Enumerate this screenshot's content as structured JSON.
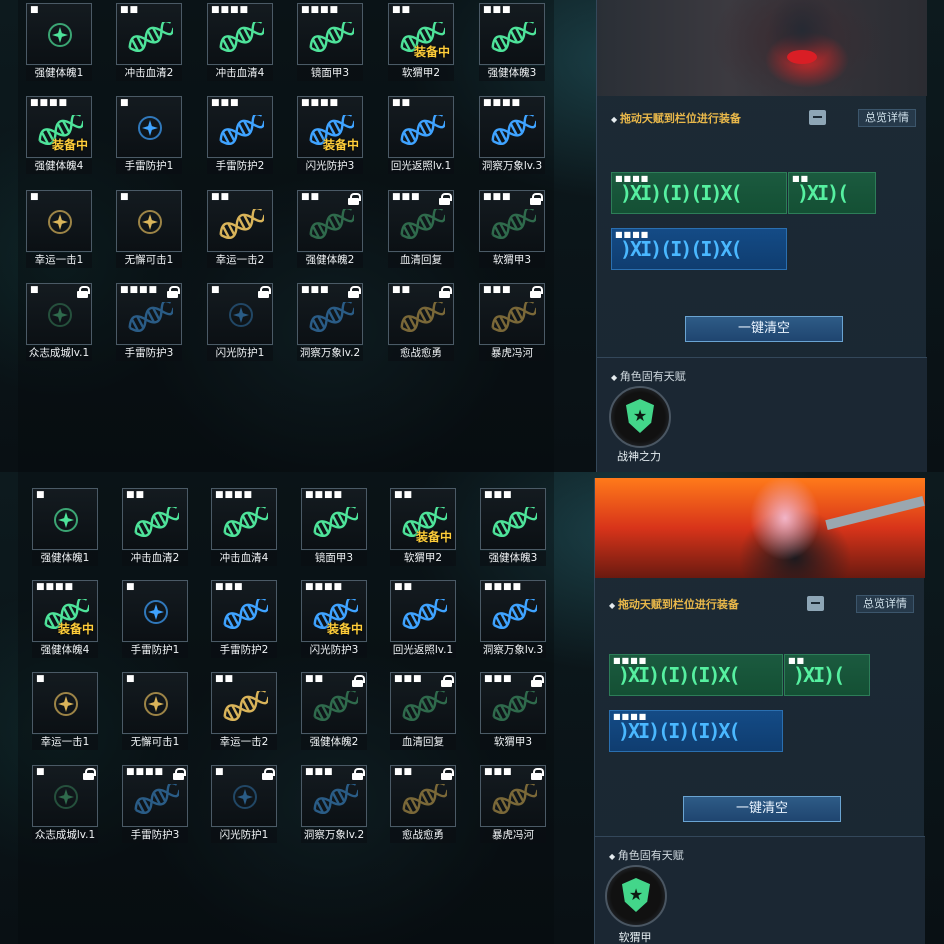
{
  "colors": {
    "green": "#4ee39a",
    "blue": "#3fa3ff",
    "gold": "#d9b45a",
    "dim_green": "#2f6a4c",
    "dim_blue": "#2a5c86",
    "dim_gold": "#7a6838"
  },
  "screens": [
    {
      "cells": [
        {
          "label": "强健体魄1",
          "dots": "■",
          "icon": "gem",
          "color": "green",
          "equipped": "",
          "locked": false
        },
        {
          "label": "冲击血清2",
          "dots": "■■",
          "icon": "dna",
          "color": "green",
          "equipped": "",
          "locked": false
        },
        {
          "label": "冲击血清4",
          "dots": "■■■■",
          "icon": "dna",
          "color": "green",
          "equipped": "",
          "locked": false
        },
        {
          "label": "镜面甲3",
          "dots": "■■■■",
          "icon": "dna",
          "color": "green",
          "equipped": "",
          "locked": false
        },
        {
          "label": "软猬甲2",
          "dots": "■■",
          "icon": "dna",
          "color": "green",
          "equipped": "装备中",
          "locked": false
        },
        {
          "label": "强健体魄3",
          "dots": "■■■",
          "icon": "dna",
          "color": "green",
          "equipped": "",
          "locked": false
        },
        {
          "label": "强健体魄4",
          "dots": "■■■■",
          "icon": "dna",
          "color": "green",
          "equipped": "装备中",
          "locked": false
        },
        {
          "label": "手雷防护1",
          "dots": "■",
          "icon": "gem",
          "color": "blue",
          "equipped": "",
          "locked": false
        },
        {
          "label": "手雷防护2",
          "dots": "■■■",
          "icon": "dna",
          "color": "blue",
          "equipped": "",
          "locked": false
        },
        {
          "label": "闪光防护3",
          "dots": "■■■■",
          "icon": "dna",
          "color": "blue",
          "equipped": "装备中",
          "locked": false
        },
        {
          "label": "回光返照lv.1",
          "dots": "■■",
          "icon": "dna",
          "color": "blue",
          "equipped": "",
          "locked": false
        },
        {
          "label": "洞察万象lv.3",
          "dots": "■■■■",
          "icon": "dna",
          "color": "blue",
          "equipped": "",
          "locked": false
        },
        {
          "label": "幸运一击1",
          "dots": "■",
          "icon": "gem",
          "color": "gold",
          "equipped": "",
          "locked": false
        },
        {
          "label": "无懈可击1",
          "dots": "■",
          "icon": "gem",
          "color": "gold",
          "equipped": "",
          "locked": false
        },
        {
          "label": "幸运一击2",
          "dots": "■■",
          "icon": "dna",
          "color": "gold",
          "equipped": "",
          "locked": false
        },
        {
          "label": "强健体魄2",
          "dots": "■■",
          "icon": "dna",
          "color": "dim_green",
          "equipped": "",
          "locked": true
        },
        {
          "label": "血清回复",
          "dots": "■■■",
          "icon": "dna",
          "color": "dim_green",
          "equipped": "",
          "locked": true
        },
        {
          "label": "软猬甲3",
          "dots": "■■■",
          "icon": "dna",
          "color": "dim_green",
          "equipped": "",
          "locked": true
        },
        {
          "label": "众志成城lv.1",
          "dots": "■",
          "icon": "gem",
          "color": "dim_green",
          "equipped": "",
          "locked": true
        },
        {
          "label": "手雷防护3",
          "dots": "■■■■",
          "icon": "dna",
          "color": "dim_blue",
          "equipped": "",
          "locked": true
        },
        {
          "label": "闪光防护1",
          "dots": "■",
          "icon": "gem",
          "color": "dim_blue",
          "equipped": "",
          "locked": true
        },
        {
          "label": "洞察万象lv.2",
          "dots": "■■■",
          "icon": "dna",
          "color": "dim_blue",
          "equipped": "",
          "locked": true
        },
        {
          "label": "愈战愈勇",
          "dots": "■■",
          "icon": "dna",
          "color": "dim_gold",
          "equipped": "",
          "locked": true
        },
        {
          "label": "暴虎冯河",
          "dots": "■■■",
          "icon": "dna",
          "color": "dim_gold",
          "equipped": "",
          "locked": true
        }
      ],
      "panel": {
        "instruction": "拖动天赋到栏位进行装备",
        "overview_button": "总览详情",
        "slot_green_big_dots": "■■■■",
        "slot_green_small_dots": "■■",
        "slot_blue_dots": "■■■■",
        "clear_button": "一键清空",
        "innate_title": "角色固有天赋",
        "innate_name": "战神之力"
      }
    },
    {
      "cells": [
        {
          "label": "强健体魄1",
          "dots": "■",
          "icon": "gem",
          "color": "green",
          "equipped": "",
          "locked": false
        },
        {
          "label": "冲击血清2",
          "dots": "■■",
          "icon": "dna",
          "color": "green",
          "equipped": "",
          "locked": false
        },
        {
          "label": "冲击血清4",
          "dots": "■■■■",
          "icon": "dna",
          "color": "green",
          "equipped": "",
          "locked": false
        },
        {
          "label": "镜面甲3",
          "dots": "■■■■",
          "icon": "dna",
          "color": "green",
          "equipped": "",
          "locked": false
        },
        {
          "label": "软猬甲2",
          "dots": "■■",
          "icon": "dna",
          "color": "green",
          "equipped": "装备中",
          "locked": false
        },
        {
          "label": "强健体魄3",
          "dots": "■■■",
          "icon": "dna",
          "color": "green",
          "equipped": "",
          "locked": false
        },
        {
          "label": "强健体魄4",
          "dots": "■■■■",
          "icon": "dna",
          "color": "green",
          "equipped": "装备中",
          "locked": false
        },
        {
          "label": "手雷防护1",
          "dots": "■",
          "icon": "gem",
          "color": "blue",
          "equipped": "",
          "locked": false
        },
        {
          "label": "手雷防护2",
          "dots": "■■■",
          "icon": "dna",
          "color": "blue",
          "equipped": "",
          "locked": false
        },
        {
          "label": "闪光防护3",
          "dots": "■■■■",
          "icon": "dna",
          "color": "blue",
          "equipped": "装备中",
          "locked": false
        },
        {
          "label": "回光返照lv.1",
          "dots": "■■",
          "icon": "dna",
          "color": "blue",
          "equipped": "",
          "locked": false
        },
        {
          "label": "洞察万象lv.3",
          "dots": "■■■■",
          "icon": "dna",
          "color": "blue",
          "equipped": "",
          "locked": false
        },
        {
          "label": "幸运一击1",
          "dots": "■",
          "icon": "gem",
          "color": "gold",
          "equipped": "",
          "locked": false
        },
        {
          "label": "无懈可击1",
          "dots": "■",
          "icon": "gem",
          "color": "gold",
          "equipped": "",
          "locked": false
        },
        {
          "label": "幸运一击2",
          "dots": "■■",
          "icon": "dna",
          "color": "gold",
          "equipped": "",
          "locked": false
        },
        {
          "label": "强健体魄2",
          "dots": "■■",
          "icon": "dna",
          "color": "dim_green",
          "equipped": "",
          "locked": true
        },
        {
          "label": "血清回复",
          "dots": "■■■",
          "icon": "dna",
          "color": "dim_green",
          "equipped": "",
          "locked": true
        },
        {
          "label": "软猬甲3",
          "dots": "■■■",
          "icon": "dna",
          "color": "dim_green",
          "equipped": "",
          "locked": true
        },
        {
          "label": "众志成城lv.1",
          "dots": "■",
          "icon": "gem",
          "color": "dim_green",
          "equipped": "",
          "locked": true
        },
        {
          "label": "手雷防护3",
          "dots": "■■■■",
          "icon": "dna",
          "color": "dim_blue",
          "equipped": "",
          "locked": true
        },
        {
          "label": "闪光防护1",
          "dots": "■",
          "icon": "gem",
          "color": "dim_blue",
          "equipped": "",
          "locked": true
        },
        {
          "label": "洞察万象lv.2",
          "dots": "■■■",
          "icon": "dna",
          "color": "dim_blue",
          "equipped": "",
          "locked": true
        },
        {
          "label": "愈战愈勇",
          "dots": "■■",
          "icon": "dna",
          "color": "dim_gold",
          "equipped": "",
          "locked": true
        },
        {
          "label": "暴虎冯河",
          "dots": "■■■",
          "icon": "dna",
          "color": "dim_gold",
          "equipped": "",
          "locked": true
        }
      ],
      "panel": {
        "instruction": "拖动天赋到栏位进行装备",
        "overview_button": "总览详情",
        "slot_green_big_dots": "■■■■",
        "slot_green_small_dots": "■■",
        "slot_blue_dots": "■■■■",
        "clear_button": "一键清空",
        "innate_title": "角色固有天赋",
        "innate_name": "软猬甲"
      }
    }
  ]
}
